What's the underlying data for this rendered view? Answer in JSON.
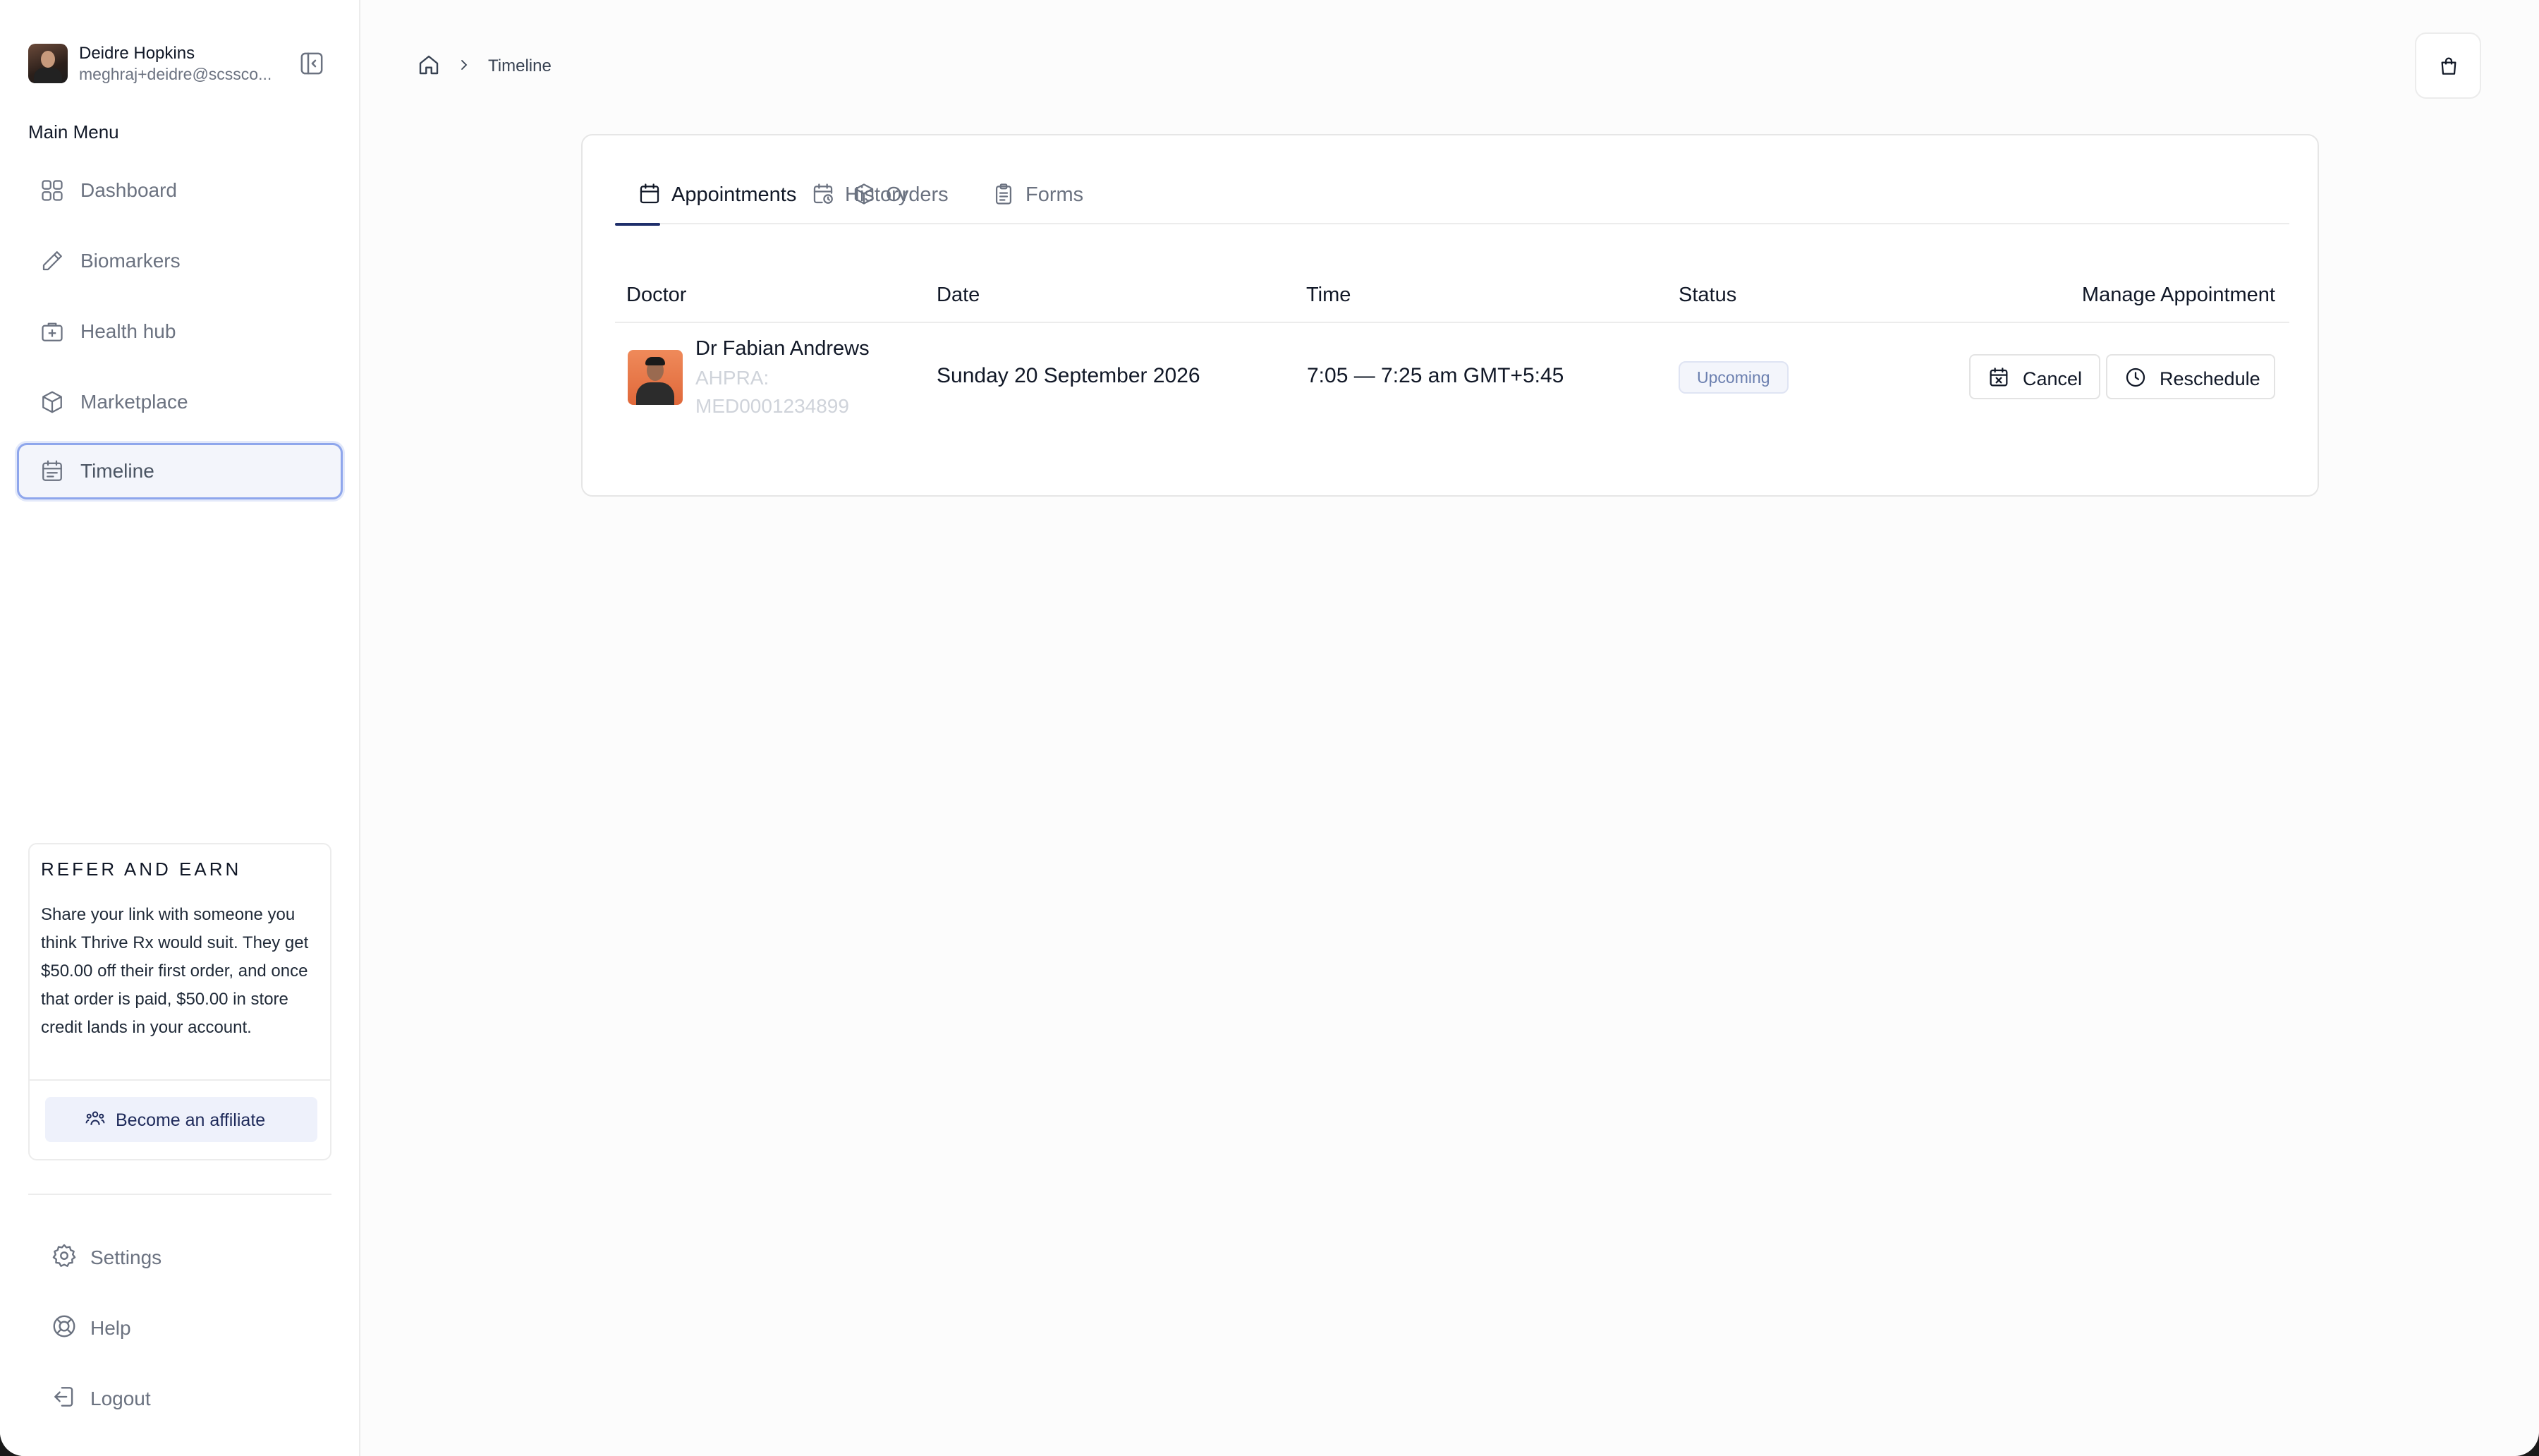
{
  "user": {
    "name": "Deidre Hopkins",
    "email": "meghraj+deidre@scssco..."
  },
  "sidebar": {
    "heading": "Main Menu",
    "items": [
      {
        "label": "Dashboard",
        "icon": "grid-icon"
      },
      {
        "label": "Biomarkers",
        "icon": "pen-icon"
      },
      {
        "label": "Health hub",
        "icon": "first-aid-kit-icon"
      },
      {
        "label": "Marketplace",
        "icon": "box-icon"
      },
      {
        "label": "Timeline",
        "icon": "calendar-icon",
        "active": true
      }
    ],
    "refer": {
      "title": "REFER AND EARN",
      "text": "Share your link with someone you think Thrive Rx would suit. They get $50.00 off their first order, and once that order is paid, $50.00 in store credit lands in your account.",
      "button": "Become an affiliate"
    },
    "bottom": [
      {
        "label": "Settings",
        "icon": "gear-icon"
      },
      {
        "label": "Help",
        "icon": "lifebuoy-icon"
      },
      {
        "label": "Logout",
        "icon": "logout-icon"
      }
    ]
  },
  "breadcrumb": {
    "current": "Timeline"
  },
  "tabs": [
    {
      "label": "Appointments",
      "active": true
    },
    {
      "label": "History"
    },
    {
      "label": "Orders"
    },
    {
      "label": "Forms"
    }
  ],
  "table": {
    "headers": {
      "doctor": "Doctor",
      "date": "Date",
      "time": "Time",
      "status": "Status",
      "manage": "Manage Appointment"
    },
    "rows": [
      {
        "doctor_name": "Dr Fabian Andrews",
        "ahpra": "AHPRA: MED0001234899",
        "date": "Sunday 20 September 2026",
        "time": "7:05 — 7:25 am GMT+5:45",
        "status": "Upcoming",
        "cancel_label": "Cancel",
        "reschedule_label": "Reschedule"
      }
    ]
  },
  "colors": {
    "accent": "#1f2f6b",
    "active_border": "#8ea6ec",
    "status_badge_text": "#6b7faf"
  }
}
